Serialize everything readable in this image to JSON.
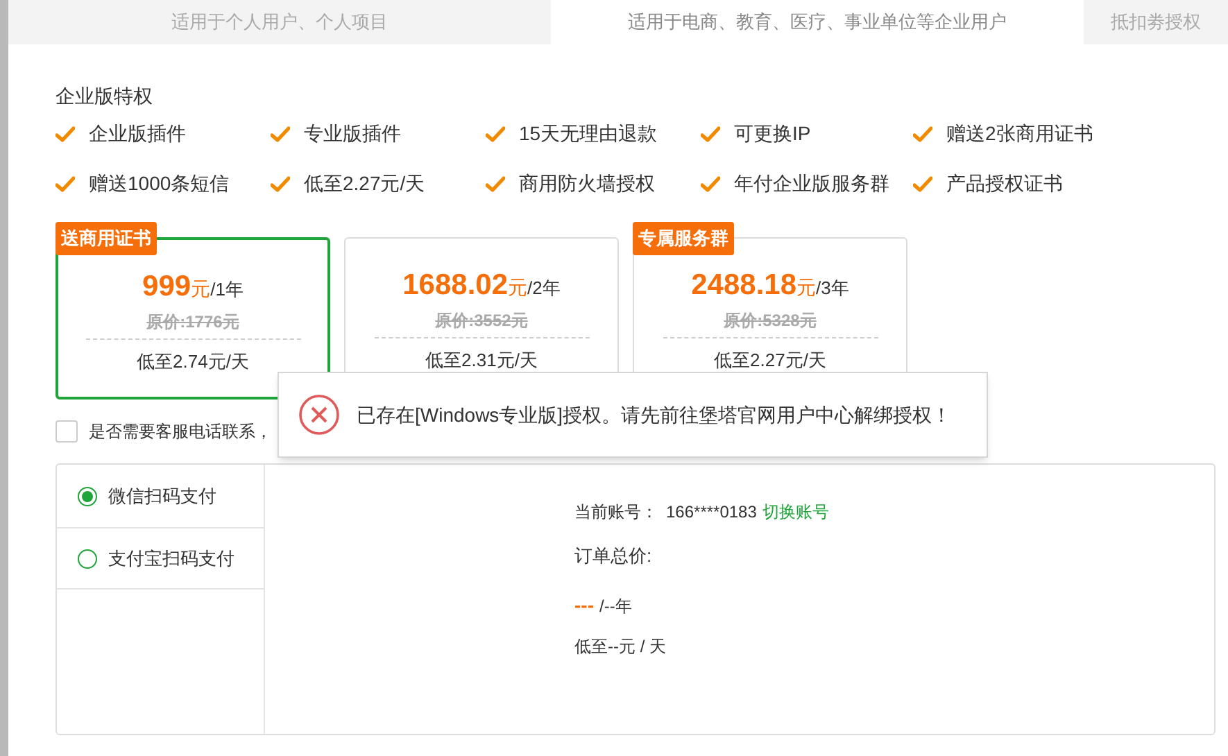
{
  "tabs": [
    {
      "label": "适用于个人用户、个人项目",
      "selected": false
    },
    {
      "label": "适用于电商、教育、医疗、事业单位等企业用户",
      "selected": true
    },
    {
      "label": "抵扣劵授权",
      "selected": false
    }
  ],
  "features": {
    "title": "企业版特权",
    "items": [
      "企业版插件",
      "专业版插件",
      "15天无理由退款",
      "可更换IP",
      "赠送2张商用证书",
      "赠送1000条短信",
      "低至2.27元/天",
      "商用防火墙授权",
      "年付企业版服务群",
      "产品授权证书"
    ]
  },
  "plans": [
    {
      "badge": "送商用证书",
      "price": "999",
      "currency": "元",
      "period": "/1年",
      "original": "原价:1776元",
      "per_day": "低至2.74元/天",
      "selected": true
    },
    {
      "price": "1688.02",
      "currency": "元",
      "period": "/2年",
      "original": "原价:3552元",
      "per_day": "低至2.31元/天",
      "selected": false
    },
    {
      "badge": "专属服务群",
      "price": "2488.18",
      "currency": "元",
      "period": "/3年",
      "original": "原价:5328元",
      "per_day": "低至2.27元/天",
      "selected": false
    }
  ],
  "contact": {
    "label": "是否需要客服电话联系，",
    "checked": false
  },
  "toast": {
    "message": "已存在[Windows专业版]授权。请先前往堡塔官网用户中心解绑授权！"
  },
  "payment_methods": [
    {
      "label": "微信扫码支付",
      "selected": true
    },
    {
      "label": "支付宝扫码支付",
      "selected": false
    }
  ],
  "order": {
    "account_label": "当前账号：",
    "account": "166****0183",
    "switch_link": "切换账号",
    "total_label": "订单总价:",
    "price": "---",
    "period": "/--年",
    "per_day": "低至--元 / 天"
  }
}
